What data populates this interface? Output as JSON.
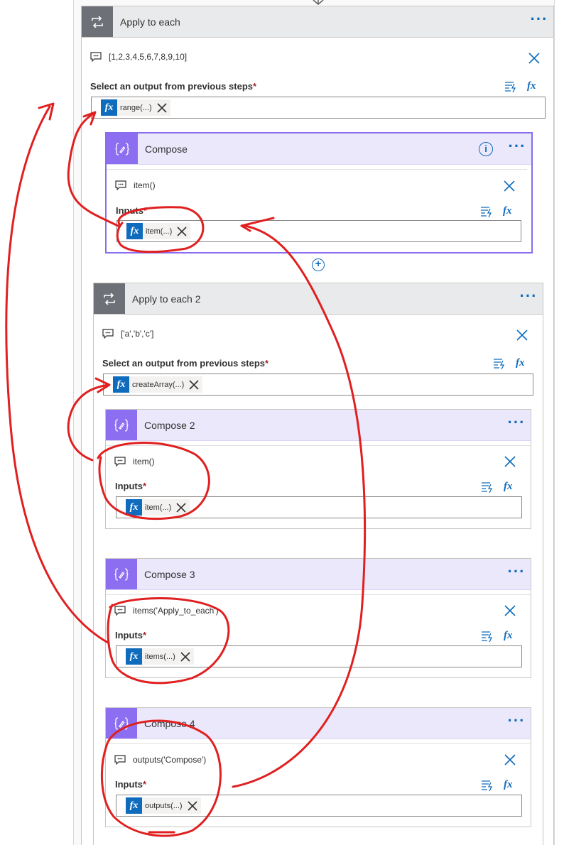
{
  "loop1": {
    "title": "Apply to each",
    "comment": "[1,2,3,4,5,6,7,8,9,10]",
    "select_label": "Select an output from previous steps",
    "token": "range(...)"
  },
  "compose1": {
    "title": "Compose",
    "comment": "item()",
    "inputs_label": "Inputs",
    "token": "item(...)"
  },
  "loop2": {
    "title": "Apply to each 2",
    "comment": "['a','b','c']",
    "select_label": "Select an output from previous steps",
    "token": "createArray(...)"
  },
  "compose2": {
    "title": "Compose 2",
    "comment": "item()",
    "inputs_label": "Inputs",
    "token": "item(...)"
  },
  "compose3": {
    "title": "Compose 3",
    "comment": "items('Apply_to_each')",
    "inputs_label": "Inputs",
    "token": "items(...)"
  },
  "compose4": {
    "title": "Compose 4",
    "comment": "outputs('Compose')",
    "inputs_label": "Inputs",
    "token": "outputs(...)"
  },
  "common": {
    "required_mark": "*",
    "more_glyph": "···",
    "fx_glyph": "fx",
    "plus_glyph": "+",
    "info_glyph": "i"
  },
  "icons": {
    "loop": "loop-icon",
    "compose": "compose-icon",
    "comment": "comment-icon",
    "close": "close-icon",
    "dynamic_content": "dynamic-content-icon",
    "expression": "fx-icon"
  },
  "colors": {
    "accent": "#0f6cbd",
    "compose_purple": "#8c6ff0",
    "loop_gray": "#6d7076",
    "annotation_red": "#e02020"
  }
}
